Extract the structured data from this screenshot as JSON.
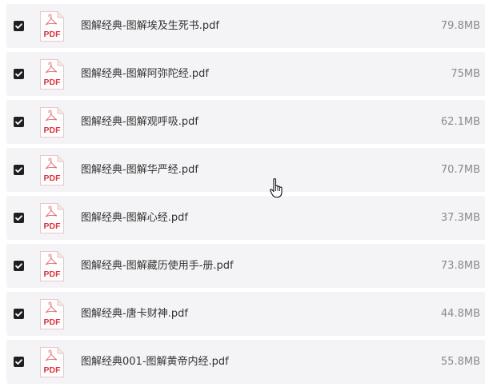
{
  "files": [
    {
      "name": "图解经典-图解埃及生死书.pdf",
      "size": "79.8MB",
      "icon_label": "PDF",
      "checked": true
    },
    {
      "name": "图解经典-图解阿弥陀经.pdf",
      "size": "75MB",
      "icon_label": "PDF",
      "checked": true
    },
    {
      "name": "图解经典-图解观呼吸.pdf",
      "size": "62.1MB",
      "icon_label": "PDF",
      "checked": true
    },
    {
      "name": "图解经典-图解华严经.pdf",
      "size": "70.7MB",
      "icon_label": "PDF",
      "checked": true
    },
    {
      "name": "图解经典-图解心经.pdf",
      "size": "37.3MB",
      "icon_label": "PDF",
      "checked": true
    },
    {
      "name": "图解经典-图解藏历使用手-册.pdf",
      "size": "73.8MB",
      "icon_label": "PDF",
      "checked": true
    },
    {
      "name": "图解经典-唐卡财神.pdf",
      "size": "44.8MB",
      "icon_label": "PDF",
      "checked": true
    },
    {
      "name": "图解经典001-图解黄帝内经.pdf",
      "size": "55.8MB",
      "icon_label": "PDF",
      "checked": true
    }
  ],
  "colors": {
    "row_background": "#f4f4f6",
    "checkbox": "#1f1f1f",
    "pdf_red": "#d9363e",
    "filename_text": "#333333",
    "size_text": "#8a8a8a"
  },
  "icons": {
    "checkbox": "checkbox-checked-icon",
    "file": "pdf-file-icon",
    "cursor": "hand-pointer-icon"
  }
}
